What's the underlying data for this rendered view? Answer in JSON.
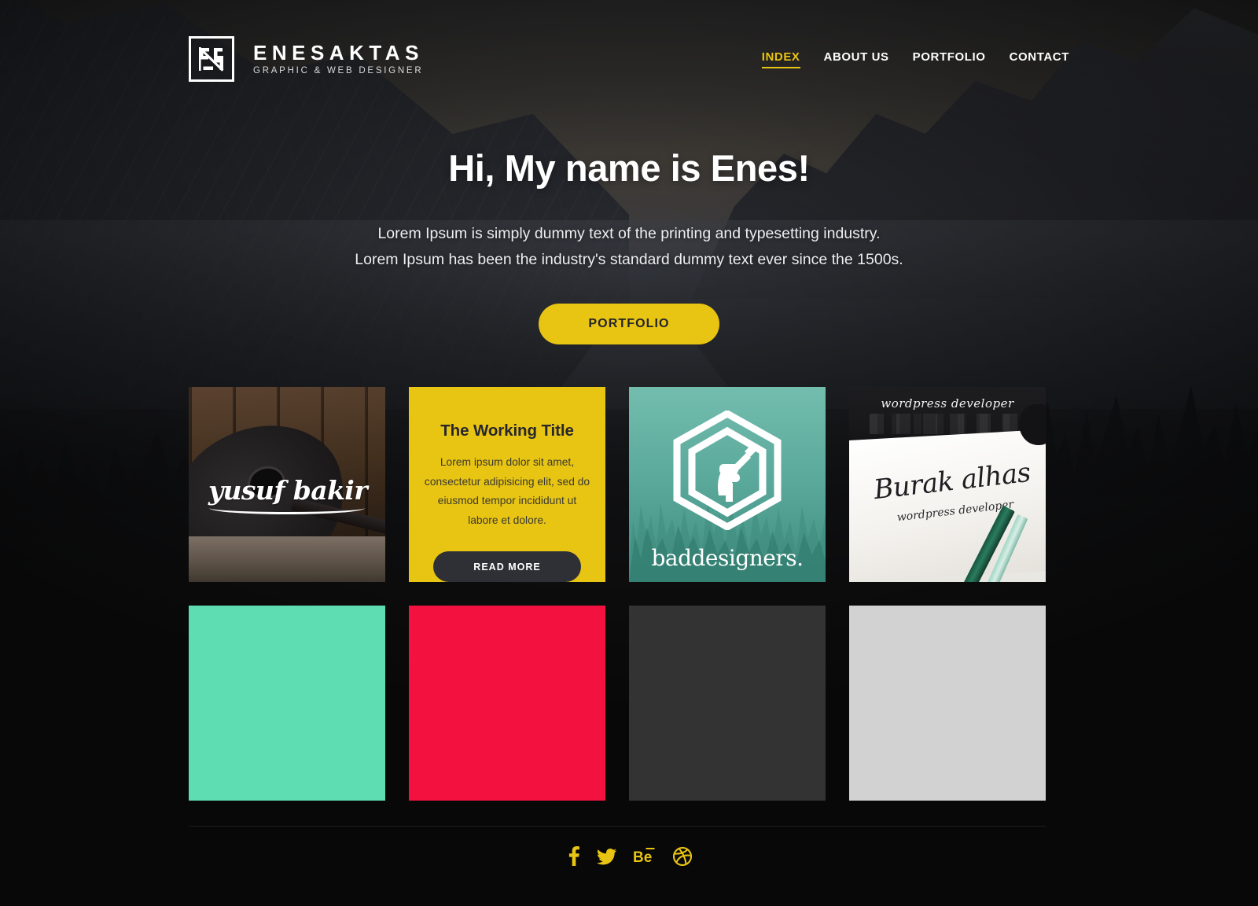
{
  "brand": {
    "logo_icon": "enesaktas-monogram-icon",
    "name": "ENESAKTAS",
    "tagline": "GRAPHIC & WEB DESIGNER"
  },
  "nav": {
    "items": [
      {
        "label": "INDEX",
        "active": true
      },
      {
        "label": "ABOUT US",
        "active": false
      },
      {
        "label": "PORTFOLIO",
        "active": false
      },
      {
        "label": "CONTACT",
        "active": false
      }
    ]
  },
  "hero": {
    "title": "Hi, My name is Enes!",
    "subtitle_line1": "Lorem Ipsum is simply dummy text of the printing and typesetting industry.",
    "subtitle_line2": "Lorem Ipsum has been the industry's standard dummy text ever since the 1500s.",
    "cta_label": "PORTFOLIO"
  },
  "portfolio": {
    "cards": [
      {
        "name": "yusuf-bakir",
        "type": "image",
        "script_text": "yusuf bakir",
        "alt": "acoustic guitar on wooden floor with yusuf bakir script logo"
      },
      {
        "name": "working-title",
        "type": "text",
        "title": "The Working Title",
        "body": "Lorem ipsum dolor sit amet, consectetur adipisicing elit, sed do eiusmod tempor incididunt ut labore et dolore.",
        "button_label": "READ MORE"
      },
      {
        "name": "baddesigners",
        "type": "image",
        "wordmark": "baddesigners.",
        "alt": "hexagon badge with fist holding pencil over forest"
      },
      {
        "name": "burak-alhas",
        "type": "image",
        "script_text": "Burak alhas",
        "sub_text": "wordpress developer",
        "top_text": "wordpress developer",
        "alt": "calligraphy lettering on paper with pencils"
      }
    ],
    "color_blocks": [
      {
        "name": "mint-block",
        "color": "#5fddb2"
      },
      {
        "name": "red-block",
        "color": "#f3123f"
      },
      {
        "name": "dark-block",
        "color": "#333333"
      },
      {
        "name": "light-block",
        "color": "#d2d2d2"
      }
    ]
  },
  "footer": {
    "social": [
      {
        "name": "facebook-icon",
        "label": "Facebook"
      },
      {
        "name": "twitter-icon",
        "label": "Twitter"
      },
      {
        "name": "behance-icon",
        "label": "Behance"
      },
      {
        "name": "dribbble-icon",
        "label": "Dribbble"
      }
    ]
  },
  "colors": {
    "accent": "#e8c413",
    "page_bg": "#1b1b1d",
    "dark_button": "#2f3036"
  }
}
